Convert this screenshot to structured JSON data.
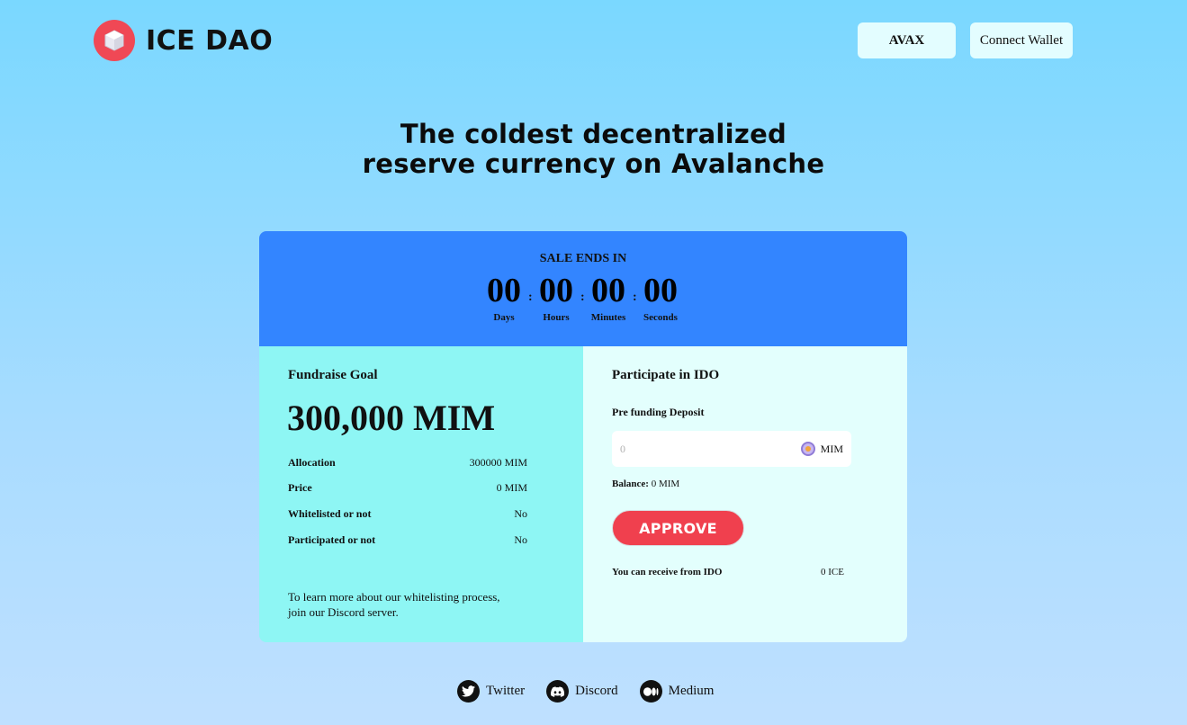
{
  "header": {
    "brand": "ICE DAO",
    "network_label": "AVAX",
    "wallet_label": "Connect Wallet"
  },
  "hero": {
    "line1": "The coldest decentralized",
    "line2": "reserve currency on Avalanche"
  },
  "countdown": {
    "title": "SALE ENDS IN",
    "days": "00",
    "days_label": "Days",
    "hours": "00",
    "hours_label": "Hours",
    "minutes": "00",
    "minutes_label": "Minutes",
    "seconds": "00",
    "seconds_label": "Seconds",
    "separator": ":"
  },
  "fundraise": {
    "title": "Fundraise Goal",
    "goal": "300,000 MIM",
    "rows": [
      {
        "label": "Allocation",
        "value": "300000 MIM"
      },
      {
        "label": "Price",
        "value": "0 MIM"
      },
      {
        "label": "Whitelisted or not",
        "value": "No"
      },
      {
        "label": "Participated or not",
        "value": "No"
      }
    ],
    "note_line1": "To learn more about our whitelisting process,",
    "note_line2": "join our Discord server."
  },
  "participate": {
    "title": "Participate in IDO",
    "deposit_label": "Pre funding Deposit",
    "deposit_placeholder": "0",
    "deposit_unit": "MIM",
    "balance_label": "Balance:",
    "balance_value": "0 MIM",
    "approve_label": "APPROVE",
    "receive_label": "You can receive from IDO",
    "receive_value": "0 ICE"
  },
  "socials": [
    {
      "label": "Twitter",
      "icon": "twitter-icon"
    },
    {
      "label": "Discord",
      "icon": "discord-icon"
    },
    {
      "label": "Medium",
      "icon": "medium-icon"
    }
  ],
  "colors": {
    "brand_red": "#f04855",
    "timer_blue": "#3385ff",
    "left_pane": "#8ef6f4",
    "right_pane": "#e3fffd"
  }
}
